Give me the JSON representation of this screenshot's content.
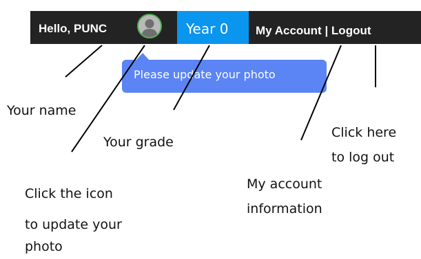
{
  "header": {
    "greeting": "Hello, PUNC",
    "grade": "Year 0",
    "my_account": "My Account",
    "separator": " | ",
    "logout": "Logout",
    "bar_color": "#232323",
    "grade_tab_color": "#0a95ef",
    "avatar_icon": "user-avatar-icon"
  },
  "tooltip": {
    "text": "Please update your photo",
    "color": "#5b84f5"
  },
  "annotations": {
    "your_name": "Your name",
    "your_grade": "Your grade",
    "icon_line1": "Click the icon",
    "icon_line2": "to update your",
    "icon_line3": "photo",
    "account_line1": "My account",
    "account_line2": "information",
    "logout_line1": "Click here",
    "logout_line2": "to log out"
  }
}
